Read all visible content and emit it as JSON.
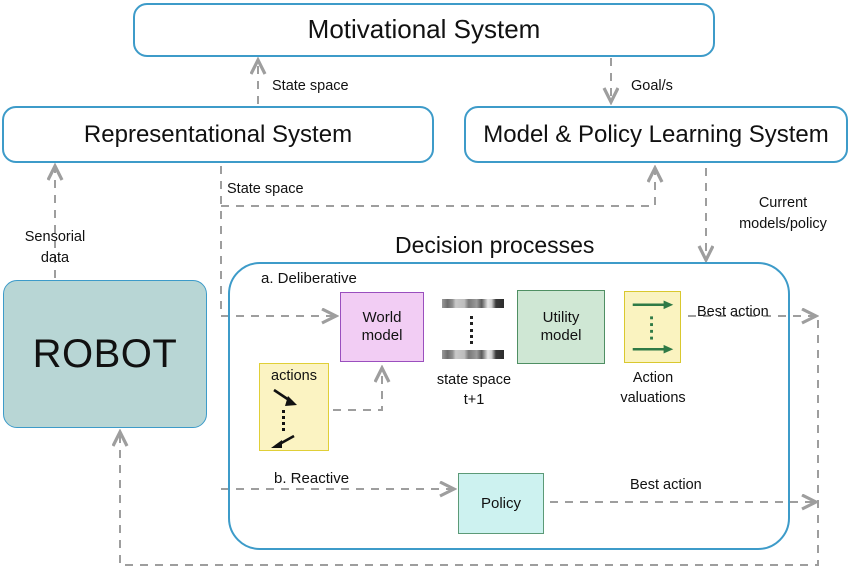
{
  "title": "Robot cognitive architecture diagram",
  "systems": {
    "motivational": "Motivational System",
    "representational": "Representational System",
    "model_policy": "Model & Policy Learning System",
    "robot": "ROBOT"
  },
  "decision": {
    "title": "Decision processes",
    "deliberative_label": "a. Deliberative",
    "reactive_label": "b. Reactive",
    "blocks": {
      "world_model": "World\nmodel",
      "world_model_line1": "World",
      "world_model_line2": "model",
      "utility_model_line1": "Utility",
      "utility_model_line2": "model",
      "actions": "actions",
      "policy": "Policy"
    },
    "captions": {
      "state_space_t1_line1": "state space",
      "state_space_t1_line2": "t+1",
      "action_valuations_line1": "Action",
      "action_valuations_line2": "valuations"
    }
  },
  "edges": {
    "state_space_up": "State space",
    "goals": "Goal/s",
    "state_space_down": "State space",
    "sensorial_data_line1": "Sensorial",
    "sensorial_data_line2": "data",
    "current_models_line1": "Current",
    "current_models_line2": "models/policy",
    "best_action_deliberative": "Best action",
    "best_action_reactive": "Best action"
  },
  "colors": {
    "system_border": "#3d9bc9",
    "robot_fill": "#b8d6d5",
    "world_model_fill": "#f2cdf4",
    "world_model_border": "#9a4fbe",
    "utility_model_fill": "#cfe7d4",
    "utility_model_border": "#4f8f63",
    "actions_fill": "#fbf3c2",
    "actions_border": "#e0cf37",
    "policy_fill": "#cdf2f0",
    "policy_border": "#5c9a77",
    "arrow_gray": "#9e9e9e",
    "arrow_green": "#2f7a46",
    "arrow_black": "#111111"
  },
  "icons": {
    "state_space_strip": "gradient-strip-icon",
    "vertical_dots": "vertical-dots-icon",
    "green_arrow": "green-right-arrow-icon",
    "black_arrow": "black-diagonal-arrow-icon"
  }
}
